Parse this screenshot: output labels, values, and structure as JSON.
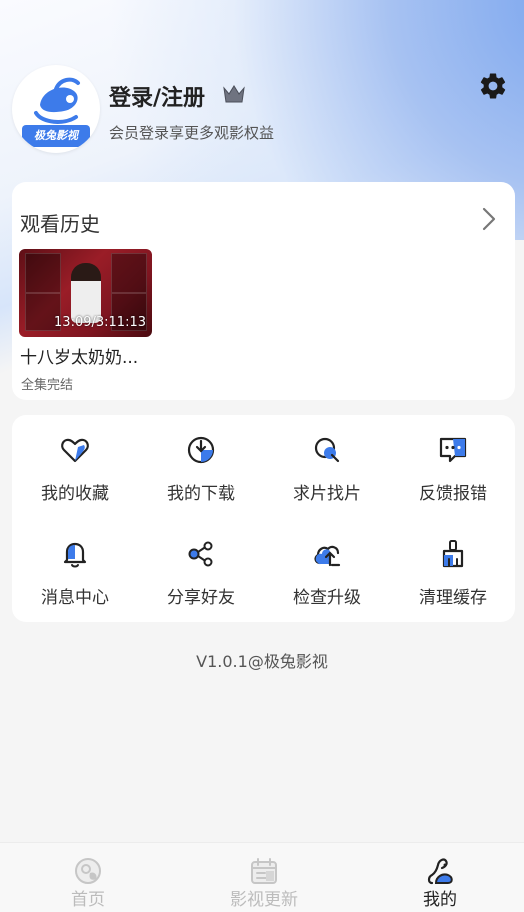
{
  "header": {
    "avatar_text": "极兔影视",
    "login_title": "登录/注册",
    "login_subtitle": "会员登录享更多观影权益"
  },
  "history": {
    "title": "观看历史",
    "items": [
      {
        "title": "十八岁太奶奶...",
        "progress": "13:09/3:11:13",
        "status": "全集完结"
      }
    ]
  },
  "menu": {
    "items": [
      {
        "label": "我的收藏",
        "icon": "heart-icon"
      },
      {
        "label": "我的下载",
        "icon": "download-icon"
      },
      {
        "label": "求片找片",
        "icon": "search-icon"
      },
      {
        "label": "反馈报错",
        "icon": "feedback-icon"
      },
      {
        "label": "消息中心",
        "icon": "bell-icon"
      },
      {
        "label": "分享好友",
        "icon": "share-icon"
      },
      {
        "label": "检查升级",
        "icon": "upgrade-icon"
      },
      {
        "label": "清理缓存",
        "icon": "broom-icon"
      }
    ]
  },
  "version": "V1.0.1@极兔影视",
  "tabs": [
    {
      "label": "首页",
      "icon": "home-icon",
      "active": false
    },
    {
      "label": "影视更新",
      "icon": "calendar-icon",
      "active": false
    },
    {
      "label": "我的",
      "icon": "profile-icon",
      "active": true
    }
  ],
  "colors": {
    "accent": "#3d7bea",
    "text_primary": "#222222",
    "text_secondary": "#555555",
    "tab_inactive": "#bcbcbc"
  }
}
